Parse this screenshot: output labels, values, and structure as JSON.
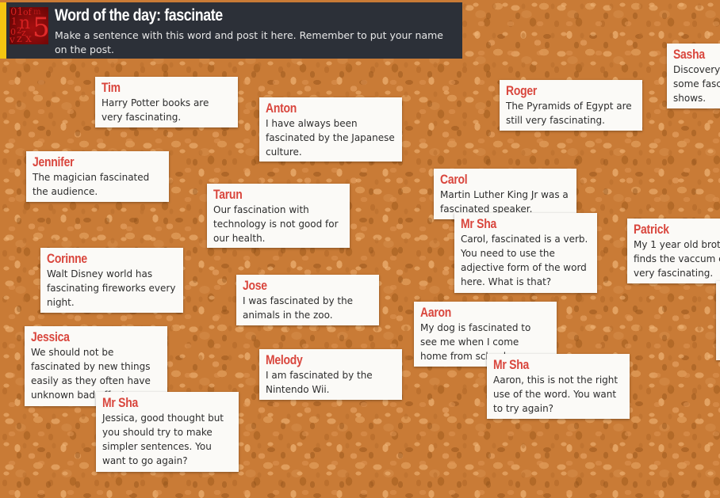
{
  "board": {
    "header": {
      "title": "Word of the day: fascinate",
      "subtitle": "Make a sentence with this word and post it here. Remember to put your name on the post.",
      "logo_icon": "numbers-collage-icon",
      "accent_color": "#f4c511"
    },
    "name_color": "#d9463d",
    "posts": [
      {
        "author": "Tim",
        "text": "Harry Potter books are very fascinating."
      },
      {
        "author": "Anton",
        "text": "I have always been fascinated by the Japanese culture."
      },
      {
        "author": "Roger",
        "text": "The Pyramids of Egypt are still very fascinating."
      },
      {
        "author": "Sasha",
        "text": "Discovery ... some fasc... shows."
      },
      {
        "author": "Jennifer",
        "text": "The magician fascinated the audience."
      },
      {
        "author": "Tarun",
        "text": "Our fascination with technology is not good for our health."
      },
      {
        "author": "Carol",
        "text": "Martin Luther King Jr was a fascinated speaker."
      },
      {
        "author": "Mr Sha",
        "text": "Carol, fascinated is a verb. You need to use the adjective form of the word here. What is that?"
      },
      {
        "author": "Patrick",
        "text": "My 1 year old brot... finds the vaccum c... very fascinating."
      },
      {
        "author": "Corinne",
        "text": "Walt Disney world has fascinating fireworks every night."
      },
      {
        "author": "Jose",
        "text": "I was fascinated by the animals in the zoo."
      },
      {
        "author": "Aaron",
        "text": "My dog is fascinated to see me when I come home from sc..."
      },
      {
        "author": "Mr Sha",
        "text": "Aaron, this is not the right use of the word. You want to try again?"
      },
      {
        "author": "Jessica",
        "text": "We should not be fascinated by new things easily as they often have unknown bad..."
      },
      {
        "author": "Melody",
        "text": "I am fascinated by the Nintendo Wii."
      },
      {
        "author": "Mr Sha",
        "text": "Jessica, good thought but you should try to make simpler sentences. You want to go again?"
      }
    ]
  }
}
